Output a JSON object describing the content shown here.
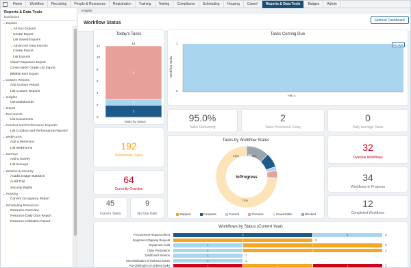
{
  "nav": {
    "tabs": [
      "Home",
      "Workflow",
      "Recruiting",
      "People & Resources",
      "Registration",
      "Training",
      "Testing",
      "Compliance",
      "Scheduling",
      "Housing",
      "Cases*",
      "Reports & Data Tools",
      "Badges",
      "Admin"
    ],
    "active_index": 11
  },
  "sidebar": {
    "title": "Reports & Data Tools",
    "subtitle": "Dashboard",
    "items": [
      {
        "label": "Exports",
        "level": 0,
        "section": true
      },
      {
        "label": "All Nox Exports",
        "level": 1,
        "section": true
      },
      {
        "label": "Create Export",
        "level": 2
      },
      {
        "label": "List Saved Exports",
        "level": 2
      },
      {
        "label": "Advanced Data Exports",
        "level": 1,
        "section": true
      },
      {
        "label": "Create Export",
        "level": 2
      },
      {
        "label": "List Exports",
        "level": 2
      },
      {
        "label": "Class* Departure Export",
        "level": 1
      },
      {
        "label": "Cross-class* Grade List Export",
        "level": 1
      },
      {
        "label": "Billable Item Export",
        "level": 1
      },
      {
        "label": "Custom Reports",
        "level": 0,
        "section": true
      },
      {
        "label": "Add Custom Report",
        "level": 1
      },
      {
        "label": "List Custom Reports",
        "level": 1
      },
      {
        "label": "Insights",
        "level": 0,
        "section": true
      },
      {
        "label": "List Dashboards",
        "level": 1
      },
      {
        "label": "Import",
        "level": 0,
        "section": true
      },
      {
        "label": "Documents",
        "level": 0,
        "section": true
      },
      {
        "label": "List Documents",
        "level": 1
      },
      {
        "label": "Conduct and Performance Reports*",
        "level": 0,
        "section": true
      },
      {
        "label": "List Conduct and Performance Reports*",
        "level": 1
      },
      {
        "label": "WebForms",
        "level": 0,
        "section": true
      },
      {
        "label": "Add a WebForm",
        "level": 1
      },
      {
        "label": "List WebForms",
        "level": 1
      },
      {
        "label": "Surveys",
        "level": 0,
        "section": true
      },
      {
        "label": "Add a Survey",
        "level": 1
      },
      {
        "label": "List Surveys",
        "level": 1
      },
      {
        "label": "Session & Security",
        "level": 0,
        "section": true
      },
      {
        "label": "Acadis Usage Statistics",
        "level": 1
      },
      {
        "label": "Audit Trail",
        "level": 1
      },
      {
        "label": "Security Rights",
        "level": 1
      },
      {
        "label": "Housing",
        "level": 0,
        "section": true
      },
      {
        "label": "Current Occupancy Report",
        "level": 1
      },
      {
        "label": "Scheduling Resources",
        "level": 0,
        "section": true
      },
      {
        "label": "Resource Overview",
        "level": 1
      },
      {
        "label": "Resource Daily Door Report",
        "level": 1
      },
      {
        "label": "Resource Utilization Report",
        "level": 1
      }
    ]
  },
  "main": {
    "breadcrumb": "Insights",
    "title": "Workflow Status",
    "refresh_label": "Refresh Dashboard"
  },
  "todays_tasks": {
    "title": "Today's Tasks",
    "total_label": "12",
    "xlabel": "Tasks by Status",
    "yticks": [
      "12",
      "10",
      "8",
      "6",
      "4",
      "2",
      "0"
    ]
  },
  "tasks_coming_due": {
    "title": "Tasks Coming Due",
    "ylabel": "Workflow Tasks",
    "yticks": [
      "1",
      "0"
    ],
    "xtick": "Feb 4",
    "legend_label": "Average"
  },
  "stats": {
    "tasks_remaining": {
      "value": "95.0%",
      "label": "Tasks Remaining"
    },
    "tasks_processed": {
      "value": "2",
      "label": "Tasks Processed Today"
    },
    "daily_average": {
      "value": "0",
      "label": "Daily Average Tasks"
    },
    "unworkable": {
      "value": "192",
      "label": "Unworkable Tasks"
    },
    "currently_overdue": {
      "value": "64",
      "label": "Currently Overdue"
    },
    "current_tasks": {
      "value": "45",
      "label": "Current Tasks"
    },
    "no_due_date": {
      "value": "9",
      "label": "No Due Date"
    },
    "overdue_workflows": {
      "value": "32",
      "label": "Overdue Workflows"
    },
    "workflows_in_progress": {
      "value": "34",
      "label": "Workflows In Progress"
    },
    "completed_workflows": {
      "value": "12",
      "label": "Completed Workflows"
    }
  },
  "tasks_by_status": {
    "title": "Tasks by Workflow Status",
    "center_label": "InProgress",
    "segment_labels": [
      "74%",
      "12%",
      "7.6%",
      "4%"
    ],
    "legend": [
      "Skipped",
      "Complete",
      "Current",
      "Overdue",
      "Unworkable",
      "Blocked"
    ]
  },
  "wf_by_status": {
    "title": "Workflows by Status (Current Year)"
  },
  "colors": {
    "skipped": "#f5a623",
    "complete": "#1d5a8a",
    "current": "#a9d5ee",
    "overdue": "#e8a09a",
    "unworkable": "#fde3b8",
    "blocked": "#7fb4d8",
    "nav_active": "#1d4f74",
    "red": "#d0021b"
  },
  "chart_data": [
    {
      "type": "bar",
      "title": "Today's Tasks",
      "xlabel": "Tasks by Status",
      "categories": [
        "Tasks by Status"
      ],
      "series": [
        {
          "name": "Complete",
          "values": [
            2
          ]
        },
        {
          "name": "Current",
          "values": [
            1
          ]
        },
        {
          "name": "Overdue",
          "values": [
            9
          ]
        }
      ],
      "total": 12,
      "ylim": [
        0,
        12
      ]
    },
    {
      "type": "area",
      "title": "Tasks Coming Due",
      "ylabel": "Workflow Tasks",
      "x": [
        "Feb 4"
      ],
      "series": [
        {
          "name": "Average",
          "values": [
            1
          ]
        }
      ],
      "ylim": [
        0,
        1
      ]
    },
    {
      "type": "pie",
      "title": "Tasks by Workflow Status",
      "labels": [
        "Unworkable",
        "Blocked",
        "Complete",
        "Current",
        "Overdue",
        "Skipped"
      ],
      "values": [
        74,
        12,
        7.6,
        2,
        4,
        0.4
      ],
      "center_label": "InProgress"
    },
    {
      "type": "bar",
      "title": "Workflows by Status (Current Year)",
      "categories": [
        "Procurement Request Sheet",
        "Equipment Shipping Request",
        "Equipment Audit",
        "Class Preparation",
        "Dashboard Session",
        "KM Distribution of Task Due Dates",
        "KM distribution of ordered tasks"
      ],
      "rows": [
        [
          {
            "color": "complete",
            "value": 2
          },
          {
            "color": "current",
            "value": 1
          }
        ],
        [
          {
            "color": "skipped",
            "value": 2
          }
        ],
        [
          {
            "color": "current",
            "value": 1
          },
          {
            "color": "skipped",
            "value": 2
          }
        ],
        [
          {
            "color": "current",
            "value": 1
          },
          {
            "color": "skipped",
            "value": 2
          }
        ],
        [
          {
            "color": "current",
            "value": 1
          }
        ],
        [
          {
            "color": "current",
            "value": 1
          }
        ],
        [
          {
            "color": "red",
            "value": 1
          },
          {
            "color": "skipped",
            "value": 1
          },
          {
            "color": "red",
            "value": 1
          }
        ]
      ],
      "totals": [
        "3",
        "2",
        "3",
        "2",
        "1",
        "1",
        "3"
      ]
    }
  ]
}
